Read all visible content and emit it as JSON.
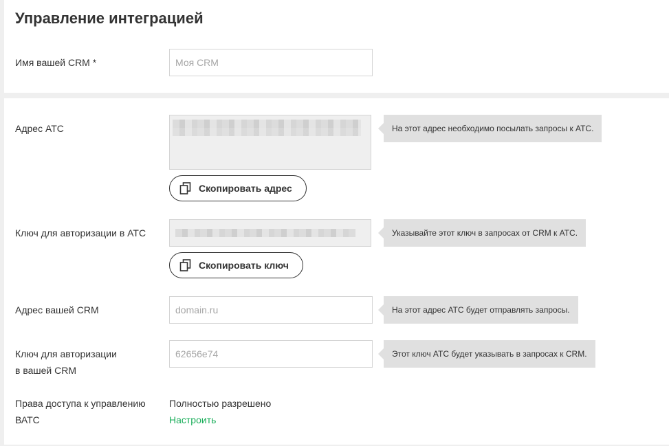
{
  "header": {
    "title": "Управление интеграцией"
  },
  "crm_name": {
    "label": "Имя вашей CRM *",
    "placeholder": "Моя CRM",
    "value": ""
  },
  "ats_address": {
    "label": "Адрес АТС",
    "hint": "На этот адрес необходимо посылать запросы к АТС.",
    "copy_button_label": "Скопировать адрес",
    "copy_icon": "copy-icon"
  },
  "ats_key": {
    "label": "Ключ для авторизации в АТС",
    "hint": "Указывайте этот ключ в запросах от CRM к АТС.",
    "copy_button_label": "Скопировать ключ",
    "copy_icon": "copy-icon"
  },
  "crm_address": {
    "label": "Адрес вашей CRM",
    "placeholder": "domain.ru",
    "value": "",
    "hint": "На этот адрес АТС будет отправлять запросы."
  },
  "crm_key": {
    "label_line1": "Ключ для авторизации",
    "label_line2": "в вашей CRM",
    "placeholder": "62656e74",
    "value": "",
    "hint": "Этот ключ АТС будет указывать в запросах к CRM."
  },
  "access_rights": {
    "label_line1": "Права доступа к управлению",
    "label_line2": "ВАТС",
    "value": "Полностью разрешено",
    "link_label": "Настроить"
  },
  "colors": {
    "link": "#1aae5a",
    "hint_background": "#e0e0e0",
    "readonly_background": "#efefef",
    "page_background": "#efefef"
  }
}
